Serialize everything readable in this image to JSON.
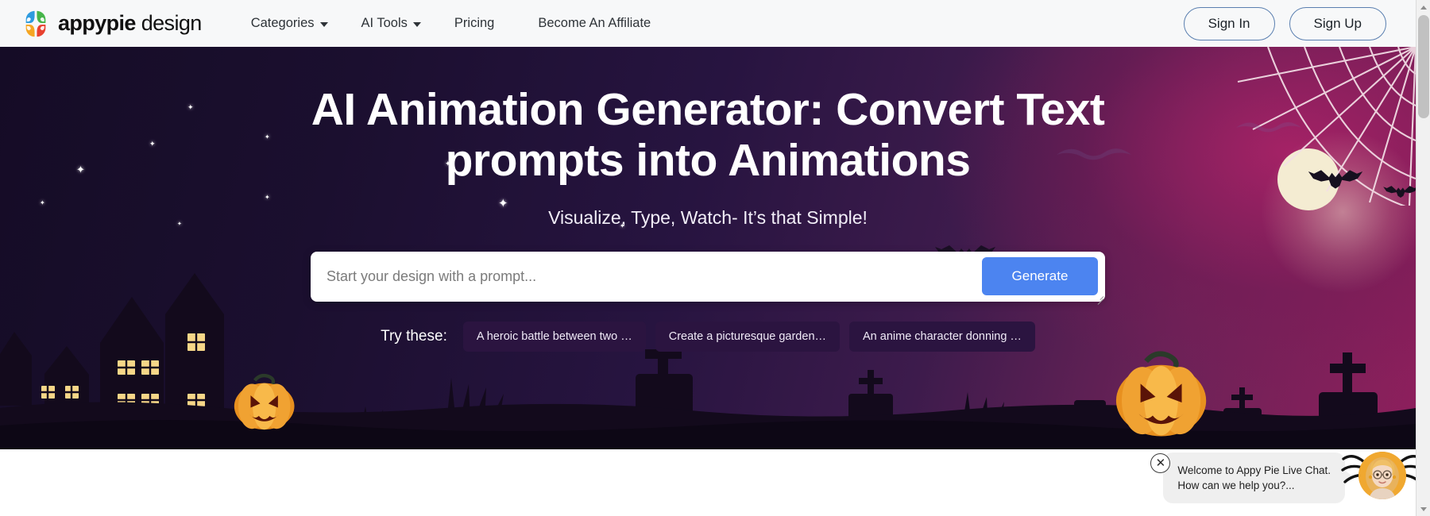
{
  "header": {
    "brand_bold": "appypie",
    "brand_light": " design",
    "logo_icon": "appypie-flower-logo",
    "nav": [
      {
        "label": "Categories",
        "has_caret": true
      },
      {
        "label": "AI Tools",
        "has_caret": true
      },
      {
        "label": "Pricing",
        "has_caret": false
      },
      {
        "label": "Become An Affiliate",
        "has_caret": false
      }
    ],
    "sign_in": "Sign In",
    "sign_up": "Sign Up"
  },
  "hero": {
    "title": "AI Animation Generator: Convert Text prompts into Animations",
    "subtitle": "Visualize, Type, Watch- It’s that Simple!",
    "prompt_placeholder": "Start your design with a prompt...",
    "prompt_value": "",
    "generate_label": "Generate",
    "try_label": "Try these:",
    "suggestions": [
      "A heroic battle between two …",
      "Create a picturesque garden…",
      "An anime character donning …"
    ],
    "theme": {
      "accent_button": "#4c84f0",
      "chip_bg": "#2b1440",
      "gradient_left": "#150c26",
      "gradient_right": "#8e1f5c",
      "moon_color": "#f4ecd2",
      "pumpkin_color": "#f0a232"
    },
    "decor": [
      "moon",
      "spider-web",
      "bats",
      "stars",
      "haunted-house",
      "gravestones",
      "jack-o-lantern",
      "grass"
    ]
  },
  "chat": {
    "message_line1": "Welcome to Appy Pie Live Chat.",
    "message_line2": "How can we help you?...",
    "close_glyph": "✕",
    "avatar_alt": "live-chat-agent-avatar"
  },
  "scrollbar": {
    "up_glyph": "▲",
    "down_glyph": "▼",
    "position": "top"
  }
}
